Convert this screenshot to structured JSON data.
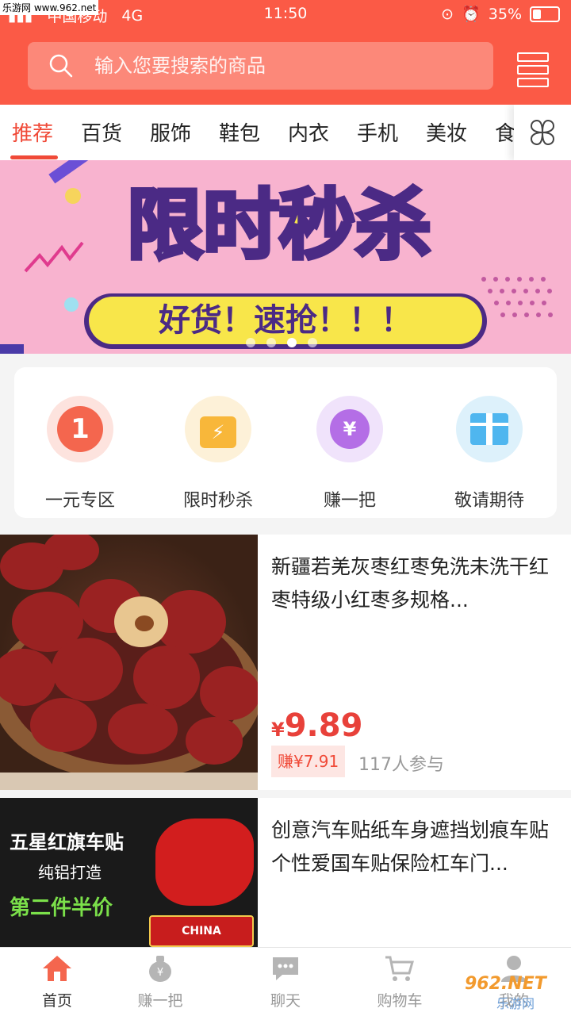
{
  "status_bar": {
    "carrier": "中国移动",
    "network": "4G",
    "time": "11:50",
    "battery": "35%"
  },
  "search": {
    "placeholder": "输入您要搜索的商品"
  },
  "tabs": [
    "推荐",
    "百货",
    "服饰",
    "鞋包",
    "内衣",
    "手机",
    "美妆",
    "食"
  ],
  "active_tab": "推荐",
  "banner": {
    "headline_1": "限时",
    "headline_2": "秒杀",
    "subline": "好货！速抢！！！",
    "dots": 4,
    "active_dot": 3
  },
  "quick_entries": [
    {
      "label": "一元专区",
      "icon": "one-yuan-icon",
      "glyph": "1"
    },
    {
      "label": "限时秒杀",
      "icon": "flash-bag-icon",
      "glyph": "⚡"
    },
    {
      "label": "赚一把",
      "icon": "money-bag-icon",
      "glyph": "¥"
    },
    {
      "label": "敬请期待",
      "icon": "gift-icon",
      "glyph": ""
    }
  ],
  "products": [
    {
      "title": "新疆若羌灰枣红枣免洗未洗干红枣特级小红枣多规格...",
      "currency": "¥",
      "price": "9.89",
      "earn": "赚¥7.91",
      "participants": "117人参与"
    },
    {
      "title": "创意汽车贴纸车身遮挡划痕车贴个性爱国车贴保险杠车门...",
      "image_text_1": "五星红旗车贴",
      "image_text_2": "纯铝打造",
      "image_text_3": "第二件半价",
      "image_text_4": "CHINA"
    }
  ],
  "tabbar": [
    {
      "label": "首页",
      "icon": "home-icon",
      "active": true
    },
    {
      "label": "赚一把",
      "icon": "money-bag-icon",
      "active": false
    },
    {
      "label": "聊天",
      "icon": "chat-icon",
      "active": false
    },
    {
      "label": "购物车",
      "icon": "cart-icon",
      "active": false
    },
    {
      "label": "我的",
      "icon": "user-icon",
      "active": false
    }
  ],
  "watermarks": {
    "top_left": "乐游网 www.962.net",
    "bottom_right_1": "962.NET",
    "bottom_right_2": "乐游网"
  },
  "colors": {
    "brand": "#fb5a46",
    "accent": "#f04a38",
    "price": "#e8413a"
  }
}
